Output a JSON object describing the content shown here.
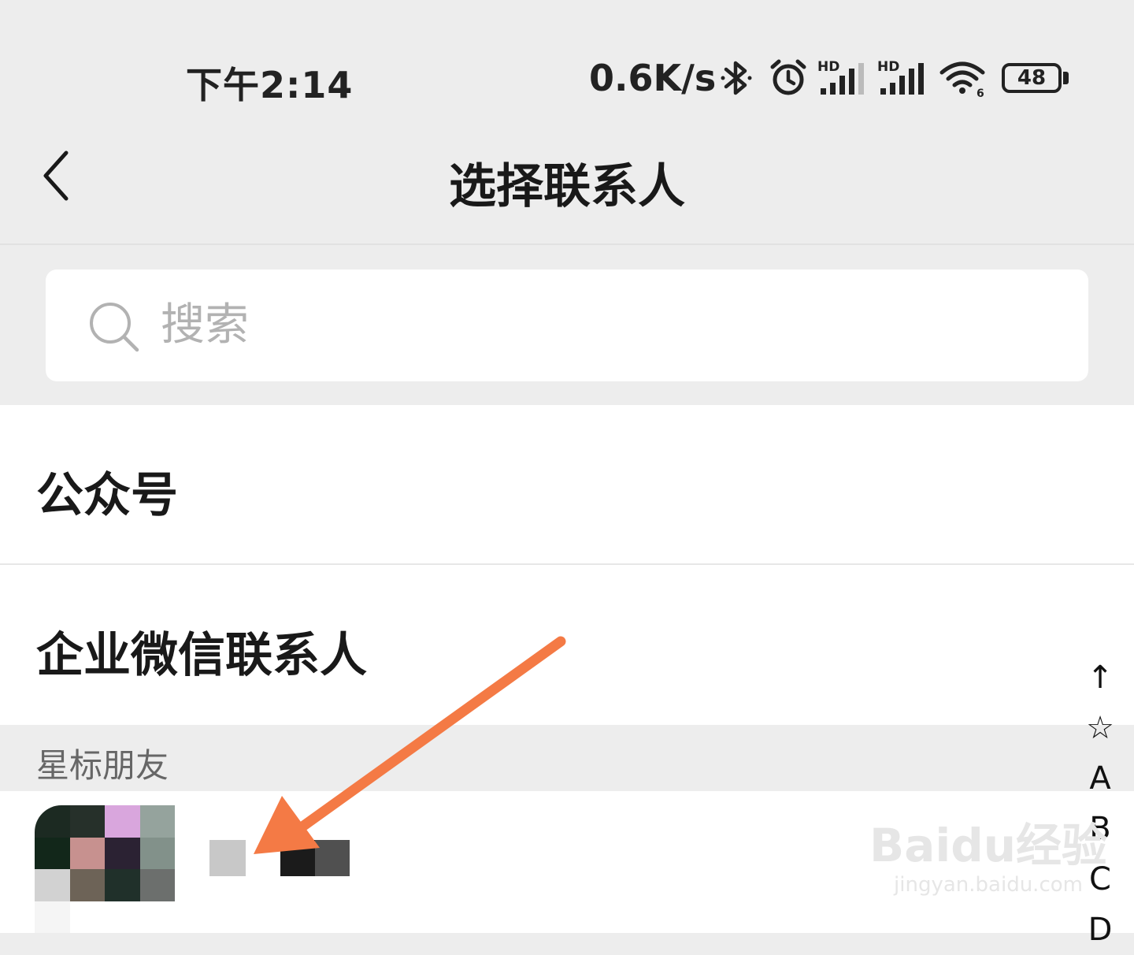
{
  "status_bar": {
    "time": "下午2:14",
    "net_speed": "0.6K/s",
    "battery": "48",
    "icons": [
      "bluetooth-icon",
      "alarm-icon",
      "hd-signal-icon",
      "hd-signal-icon",
      "wifi-icon"
    ]
  },
  "nav": {
    "title": "选择联系人",
    "back_icon": "chevron-left-icon"
  },
  "search": {
    "placeholder": "搜索"
  },
  "list": {
    "rows": [
      {
        "label": "公众号"
      },
      {
        "label": "企业微信联系人"
      }
    ],
    "section_header": "星标朋友"
  },
  "index_bar": [
    "↑",
    "☆",
    "A",
    "B",
    "C",
    "D"
  ],
  "watermark": {
    "main": "Baidu经验",
    "sub": "jingyan.baidu.com"
  },
  "colors": {
    "background": "#ededed",
    "surface": "#ffffff",
    "annotation_arrow": "#f47a45",
    "placeholder": "#b2b2b2"
  }
}
